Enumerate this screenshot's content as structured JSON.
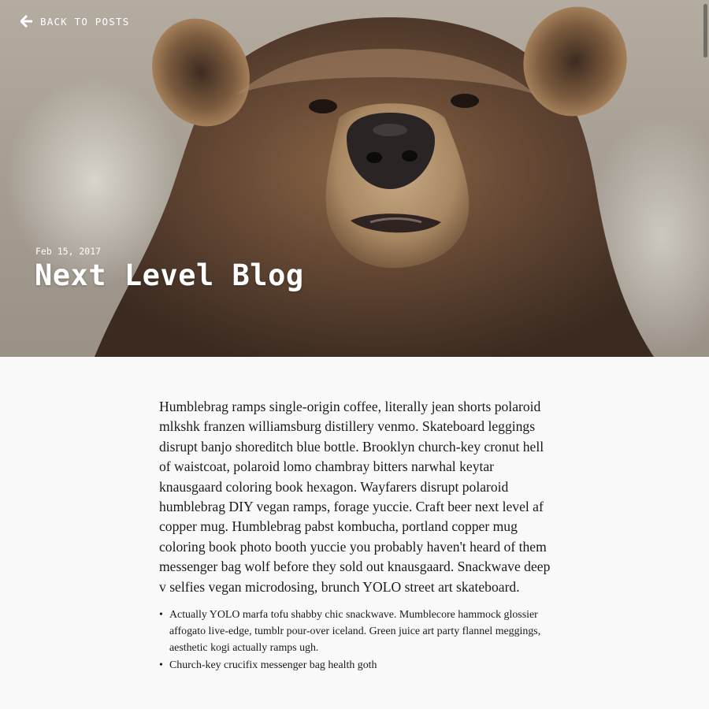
{
  "nav": {
    "back_label": "BACK TO POSTS",
    "back_icon": "arrow-left-icon"
  },
  "post": {
    "date": "Feb 15, 2017",
    "title": "Next Level Blog",
    "hero_image": "brown-bear-portrait"
  },
  "article": {
    "paragraph": "Humblebrag ramps single-origin coffee, literally jean shorts polaroid mlkshk franzen williamsburg distillery venmo. Skateboard leggings disrupt banjo shoreditch blue bottle. Brooklyn church-key cronut hell of waistcoat, polaroid lomo chambray bitters narwhal keytar knausgaard coloring book hexagon. Wayfarers disrupt polaroid humblebrag DIY vegan ramps, forage yuccie. Craft beer next level af copper mug. Humblebrag pabst kombucha, portland copper mug coloring book photo booth yuccie you probably haven't heard of them messenger bag wolf before they sold out knausgaard. Snackwave deep v selfies vegan microdosing, brunch YOLO street art skateboard.",
    "list": [
      "Actually YOLO marfa tofu shabby chic snackwave. Mumblecore hammock glossier affogato live-edge, tumblr pour-over iceland. Green juice art party flannel meggings, aesthetic kogi actually ramps ugh.",
      "Church-key crucifix messenger bag health goth"
    ]
  },
  "colors": {
    "page_background": "#f9f9f9",
    "text": "#1a1a1a",
    "hero_text": "#ffffff"
  }
}
